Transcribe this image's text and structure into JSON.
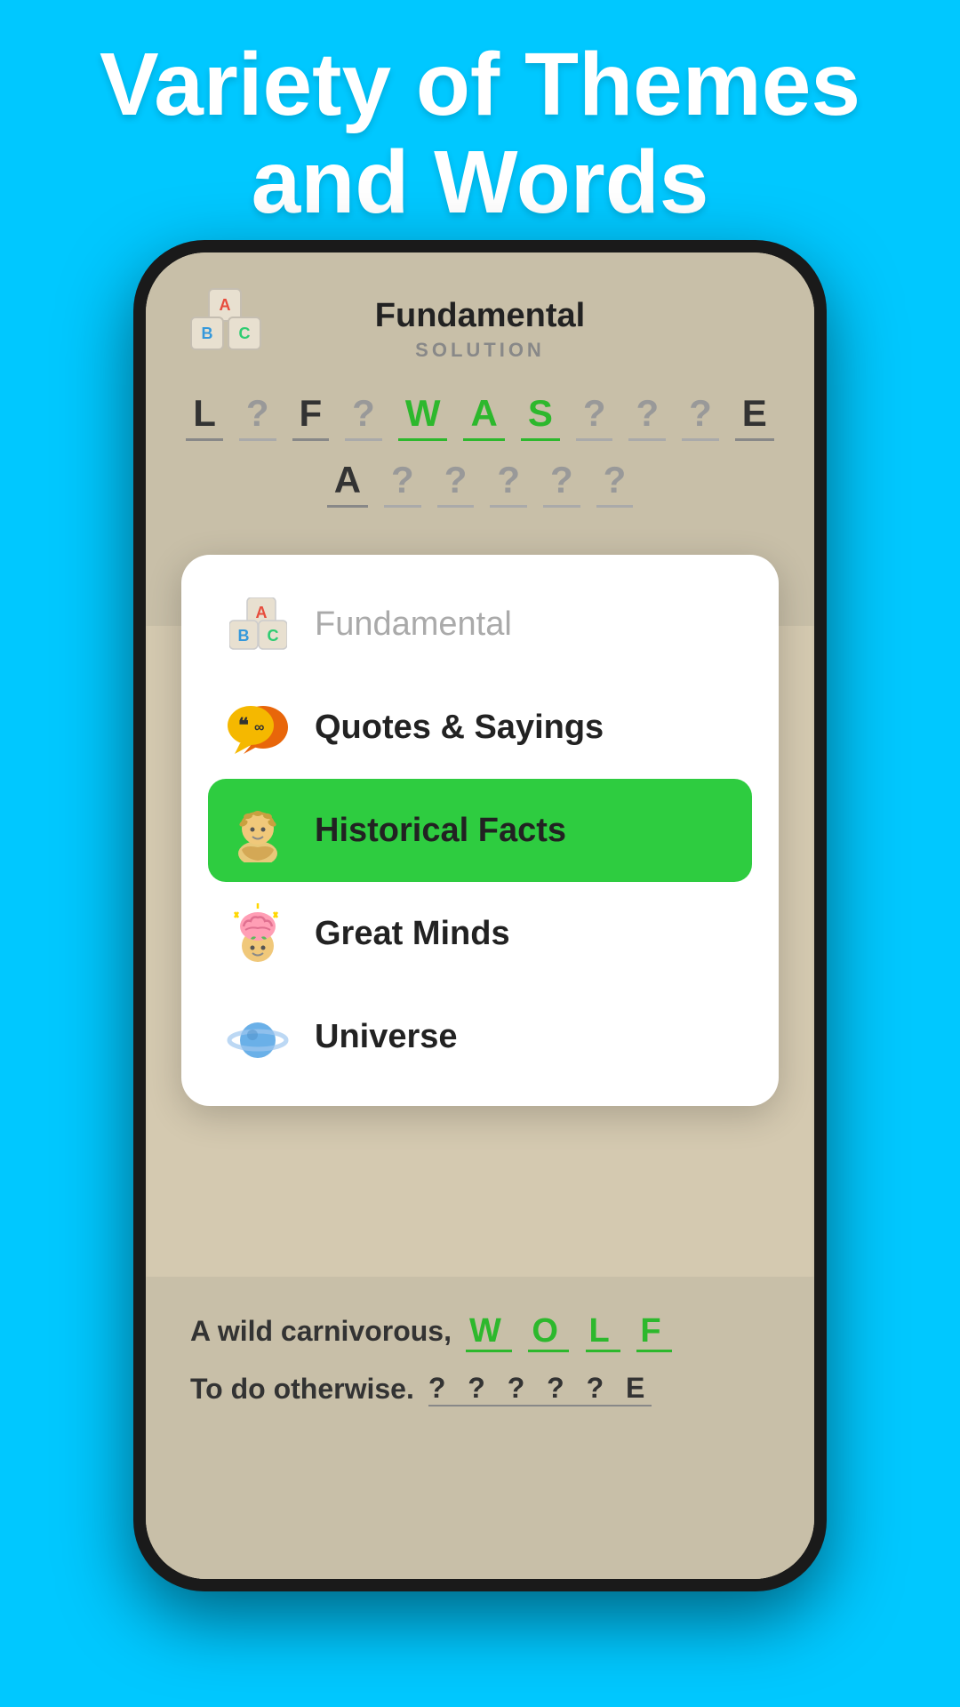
{
  "header": {
    "title_line1": "Variety of Themes",
    "title_line2": "and Words"
  },
  "game": {
    "logo_a": "A",
    "logo_b": "B",
    "logo_c": "C",
    "title": "Fundamental",
    "subtitle": "SOLUTION",
    "word_row1": [
      "L",
      "?",
      "F",
      "?",
      "W",
      "A",
      "S",
      "?",
      "?",
      "?",
      "E"
    ],
    "word_row2": [
      "A",
      "?",
      "?",
      "?",
      "?",
      "?"
    ],
    "bottom_clue1": "A wild carnivorous,",
    "bottom_answer1": "WOLF",
    "bottom_clue2": "To do otherwise.",
    "bottom_answer2": "? ? ? ? ? E"
  },
  "menu": {
    "items": [
      {
        "id": "fundamental",
        "label": "Fundamental",
        "icon": "🔤",
        "active": false,
        "faded": true
      },
      {
        "id": "quotes-sayings",
        "label": "Quotes & Sayings",
        "icon": "💬",
        "active": false,
        "faded": false
      },
      {
        "id": "historical-facts",
        "label": "Historical Facts",
        "icon": "🏛️",
        "active": true,
        "faded": false
      },
      {
        "id": "great-minds",
        "label": "Great Minds",
        "icon": "🧠",
        "active": false,
        "faded": false
      },
      {
        "id": "universe",
        "label": "Universe",
        "icon": "🪐",
        "active": false,
        "faded": false
      }
    ]
  },
  "colors": {
    "background": "#00c8ff",
    "active_green": "#2ecc40",
    "text_white": "#ffffff",
    "text_dark": "#222222",
    "text_gray": "#aaaaaa",
    "word_green": "#2db82d"
  }
}
